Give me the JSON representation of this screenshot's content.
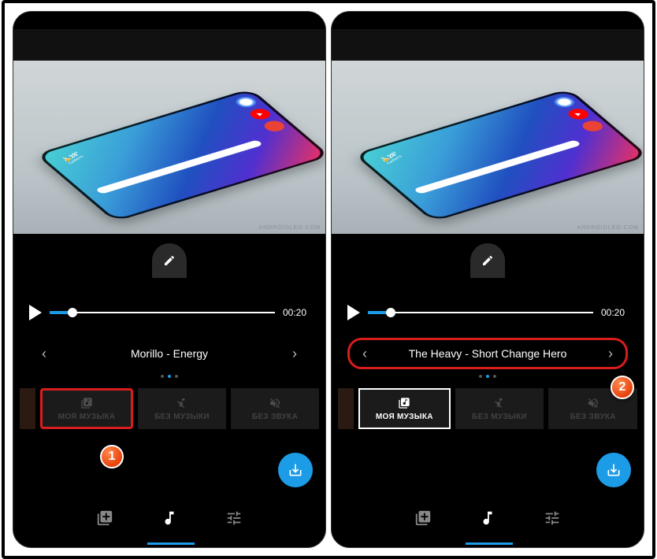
{
  "duration": "00:20",
  "weather_temp": "28°",
  "weather_city": "Canberra",
  "watermark": "ANDROIDLEO.COM",
  "left": {
    "song": "Morillo - Energy",
    "cards": {
      "my": "МОЯ МУЗЫКА",
      "no": "БЕЗ МУЗЫКИ",
      "mute": "БЕЗ ЗВУКА"
    },
    "badge": "1"
  },
  "right": {
    "song": "The Heavy - Short Change Hero",
    "cards": {
      "my": "МОЯ МУЗЫКА",
      "no": "БЕЗ МУЗЫКИ",
      "mute": "БЕЗ ЗВУКА"
    },
    "badge": "2"
  }
}
